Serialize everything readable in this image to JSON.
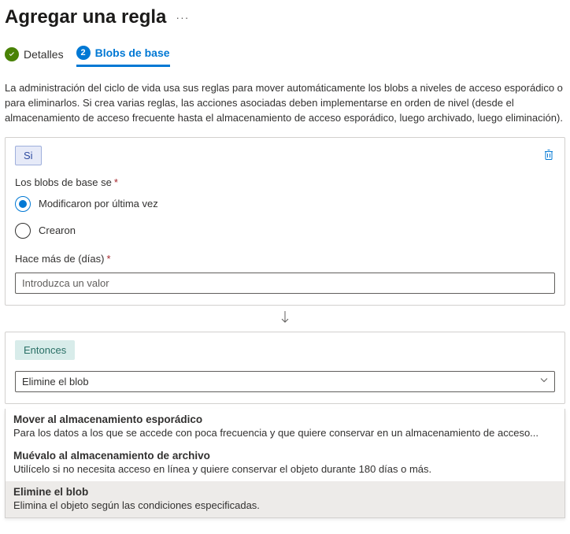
{
  "header": {
    "title": "Agregar una regla"
  },
  "tabs": {
    "step1_label": "Detalles",
    "step2_number": "2",
    "step2_label": "Blobs de base"
  },
  "description": "La administración del ciclo de vida usa sus reglas para mover automáticamente los blobs a niveles de acceso esporádico o para eliminarlos. Si crea varias reglas, las acciones asociadas deben implementarse en orden de nivel (desde el almacenamiento de acceso frecuente hasta el almacenamiento de acceso esporádico, luego archivado, luego eliminación).",
  "if_block": {
    "chip": "Si",
    "base_blobs_label": "Los blobs de base se",
    "radio_modified": "Modificaron por última vez",
    "radio_created": "Crearon",
    "days_label": "Hace más de (días)",
    "days_placeholder": "Introduzca un valor"
  },
  "then_block": {
    "chip": "Entonces",
    "selected_value": "Elimine el blob",
    "options": [
      {
        "title": "Mover al almacenamiento esporádico",
        "sub": "Para los datos a los que se accede con poca frecuencia y que quiere conservar en un almacenamiento de acceso..."
      },
      {
        "title": "Muévalo al almacenamiento de archivo",
        "sub": "Utilícelo si no necesita acceso en línea y quiere conservar el objeto durante 180 días o más."
      },
      {
        "title": "Elimine el blob",
        "sub": "Elimina el objeto según las condiciones especificadas."
      }
    ]
  }
}
